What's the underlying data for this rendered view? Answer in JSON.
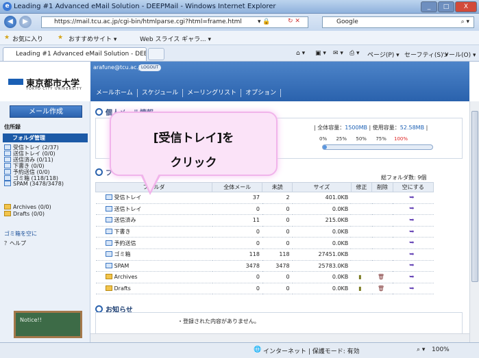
{
  "window": {
    "title": "Leading #1 Advanced eMail Solution - DEEPMail - Windows Internet Explorer",
    "minimize": "_",
    "maximize": "□",
    "close": "X"
  },
  "address": {
    "url": "https://mail.tcu.ac.jp/cgi-bin/htmlparse.cgi?html=frame.html",
    "search_label": "Google"
  },
  "favorites": {
    "fav_label": "お気に入り",
    "suggest": "おすすめサイト ▾",
    "webslice": "Web スライス ギャラ... ▾"
  },
  "tab": {
    "label": "Leading #1 Advanced eMail Solution - DEEP..."
  },
  "commands": {
    "page": "ページ(P) ▾",
    "safety": "セーフティ(S) ▾",
    "tools": "ツール(O) ▾"
  },
  "site": {
    "logo": "東京都市大学",
    "logo_sub": "TOKYO CITY UNIVERSITY",
    "user": "arafune@tcu.ac.jp",
    "logout": "LOGOUT",
    "nav": [
      "メールホーム",
      "スケジュール",
      "メーリングリスト",
      "オプション"
    ]
  },
  "left": {
    "compose": "メール作成",
    "addressbook": "住所録",
    "folder_mgmt": "フォルダ管理",
    "folders": [
      "受信トレイ (2/37)",
      "送信トレイ (0/0)",
      "送信済み (0/11)",
      "下書き (0/0)",
      "予約送信 (0/0)",
      "ゴミ箱 (118/118)",
      "SPAM (3478/3478)"
    ],
    "folders2": [
      "Archives (0/0)",
      "Drafts (0/0)"
    ],
    "empty_trash": "ゴミ箱を空に",
    "help": "？ヘルプ"
  },
  "main": {
    "personal_title": "個人メール情報",
    "quota_prefix": "全体容量：",
    "quota_total": "1500MB",
    "usage_prefix": "使用容量：",
    "quota_used": "52.58MB",
    "usage_percent": 3.5,
    "scale": [
      "0%",
      "25%",
      "50%",
      "75%",
      "100%"
    ],
    "folders_title": "フ",
    "folder_count": "総フォルダ数: 9個",
    "columns": [
      "フォルダ",
      "全体メール",
      "未読",
      "サイズ",
      "修正",
      "削除",
      "空にする"
    ],
    "rows": [
      {
        "name": "受信トレイ",
        "total": "37",
        "unread": "2",
        "size": "401.0KB",
        "y": false
      },
      {
        "name": "送信トレイ",
        "total": "0",
        "unread": "0",
        "size": "0.0KB",
        "y": false
      },
      {
        "name": "送信済み",
        "total": "11",
        "unread": "0",
        "size": "215.0KB",
        "y": false
      },
      {
        "name": "下書き",
        "total": "0",
        "unread": "0",
        "size": "0.0KB",
        "y": false
      },
      {
        "name": "予約送信",
        "total": "0",
        "unread": "0",
        "size": "0.0KB",
        "y": false
      },
      {
        "name": "ゴミ箱",
        "total": "118",
        "unread": "118",
        "size": "27451.0KB",
        "y": false
      },
      {
        "name": "SPAM",
        "total": "3478",
        "unread": "3478",
        "size": "25783.0KB",
        "y": false
      },
      {
        "name": "Archives",
        "total": "0",
        "unread": "0",
        "size": "0.0KB",
        "y": true
      },
      {
        "name": "Drafts",
        "total": "0",
        "unread": "0",
        "size": "0.0KB",
        "y": true
      }
    ],
    "notice_title": "お知らせ",
    "notice_text": "・登録された内容がありません。",
    "notice_board": "Notice!!"
  },
  "callout": {
    "line1": "[受信トレイ]を",
    "line2": "クリック"
  },
  "status": {
    "zone": "インターネット | 保護モード: 有効",
    "zoom": "100%"
  }
}
